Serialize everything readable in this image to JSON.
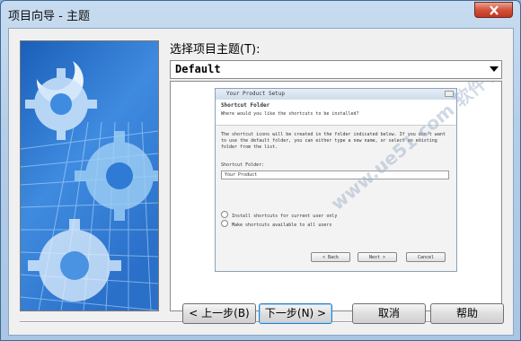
{
  "window": {
    "title": "项目向导 - 主题"
  },
  "theme_label": "选择项目主题(T):",
  "theme_select": {
    "value": "Default"
  },
  "preview": {
    "window_title": "Your Product Setup",
    "heading": "Shortcut Folder",
    "subheading": "Where would you like the shortcuts to be installed?",
    "description": "The shortcut icons will be created in the folder indicated below. If you don't want to use the default folder, you can either type a new name, or select an existing folder from the list.",
    "folder_label": "Shortcut Folder:",
    "folder_value": "Your Product",
    "radio_current_user": "Install shortcuts for current user only",
    "radio_all_users": "Make shortcuts available to all users",
    "back_label": "< Back",
    "next_label": "Next >",
    "cancel_label": "Cancel"
  },
  "buttons": {
    "back": "< 上一步(B)",
    "next": "下一步(N) >",
    "cancel": "取消",
    "help": "帮助"
  },
  "watermark": "www.ue51.com 软件学园"
}
